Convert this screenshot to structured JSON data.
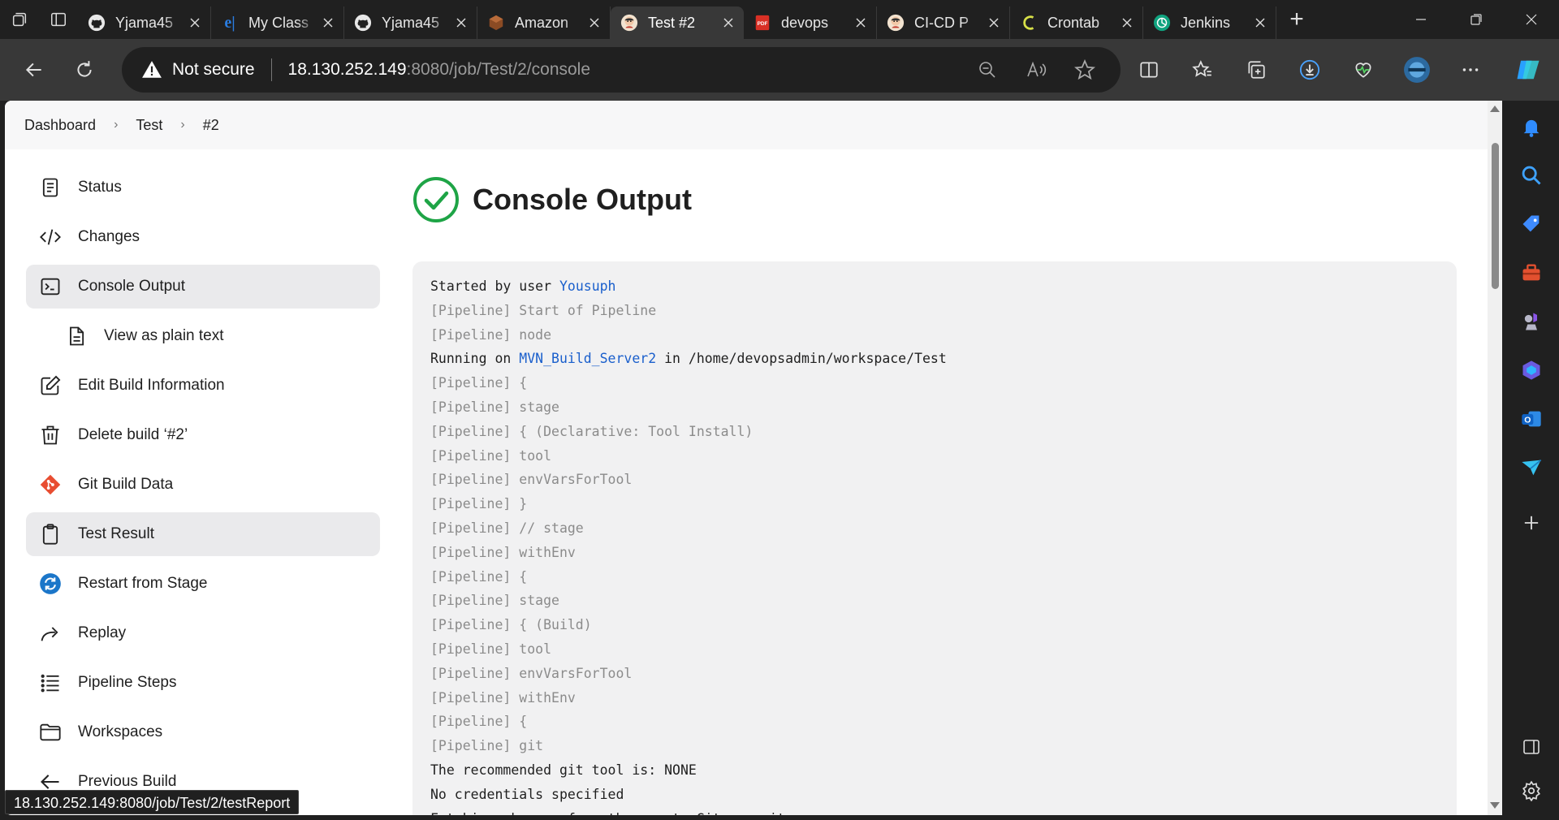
{
  "browser": {
    "tabs": [
      {
        "title": "Yjama45",
        "favicon": "github-icon"
      },
      {
        "title": "My Class",
        "favicon": "edureka-icon"
      },
      {
        "title": "Yjama45",
        "favicon": "github-icon"
      },
      {
        "title": "Amazon",
        "favicon": "aws-icon"
      },
      {
        "title": "Test #2",
        "favicon": "jenkins-icon",
        "active": true
      },
      {
        "title": "devops",
        "favicon": "pdf-icon"
      },
      {
        "title": "CI-CD P",
        "favicon": "jenkins-icon"
      },
      {
        "title": "Crontab",
        "favicon": "crontab-icon"
      },
      {
        "title": "Jenkins",
        "favicon": "chatgpt-icon"
      }
    ],
    "address": {
      "security_label": "Not secure",
      "host": "18.130.252.149",
      "path": ":8080/job/Test/2/console"
    },
    "status_url": "18.130.252.149:8080/job/Test/2/testReport"
  },
  "breadcrumb": {
    "items": [
      "Dashboard",
      "Test",
      "#2"
    ]
  },
  "nav": {
    "items": [
      {
        "label": "Status",
        "icon": "document-icon"
      },
      {
        "label": "Changes",
        "icon": "code-icon"
      },
      {
        "label": "Console Output",
        "icon": "terminal-icon",
        "selected": true
      },
      {
        "label": "View as plain text",
        "icon": "file-icon",
        "sub": true
      },
      {
        "label": "Edit Build Information",
        "icon": "edit-icon"
      },
      {
        "label": "Delete build ‘#2’",
        "icon": "trash-icon"
      },
      {
        "label": "Git Build Data",
        "icon": "git-icon"
      },
      {
        "label": "Test Result",
        "icon": "clipboard-icon",
        "selected": true
      },
      {
        "label": "Restart from Stage",
        "icon": "restart-icon"
      },
      {
        "label": "Replay",
        "icon": "replay-icon"
      },
      {
        "label": "Pipeline Steps",
        "icon": "steps-icon"
      },
      {
        "label": "Workspaces",
        "icon": "folder-icon"
      },
      {
        "label": "Previous Build",
        "icon": "arrow-left-icon"
      }
    ]
  },
  "main": {
    "title": "Console Output",
    "console_lines": [
      {
        "text": "Started by user ",
        "link": "Yousuph",
        "rest": ""
      },
      {
        "text": "[Pipeline] Start of Pipeline"
      },
      {
        "text": "[Pipeline] node"
      },
      {
        "text": "Running on ",
        "link": "MVN_Build_Server2",
        "rest": " in /home/devopsadmin/workspace/Test"
      },
      {
        "text": "[Pipeline] {"
      },
      {
        "text": "[Pipeline] stage"
      },
      {
        "text": "[Pipeline] { (Declarative: Tool Install)"
      },
      {
        "text": "[Pipeline] tool"
      },
      {
        "text": "[Pipeline] envVarsForTool"
      },
      {
        "text": "[Pipeline] }"
      },
      {
        "text": "[Pipeline] // stage"
      },
      {
        "text": "[Pipeline] withEnv"
      },
      {
        "text": "[Pipeline] {"
      },
      {
        "text": "[Pipeline] stage"
      },
      {
        "text": "[Pipeline] { (Build)"
      },
      {
        "text": "[Pipeline] tool"
      },
      {
        "text": "[Pipeline] envVarsForTool"
      },
      {
        "text": "[Pipeline] withEnv"
      },
      {
        "text": "[Pipeline] {"
      },
      {
        "text": "[Pipeline] git"
      },
      {
        "text": "The recommended git tool is: NONE"
      },
      {
        "text": "No credentials specified"
      },
      {
        "text": "Fetching changes from the remote Git repository"
      }
    ]
  },
  "colors": {
    "success": "#1ea446",
    "link": "#1a5fcc",
    "pipeline_text": "#8b8b8b"
  }
}
